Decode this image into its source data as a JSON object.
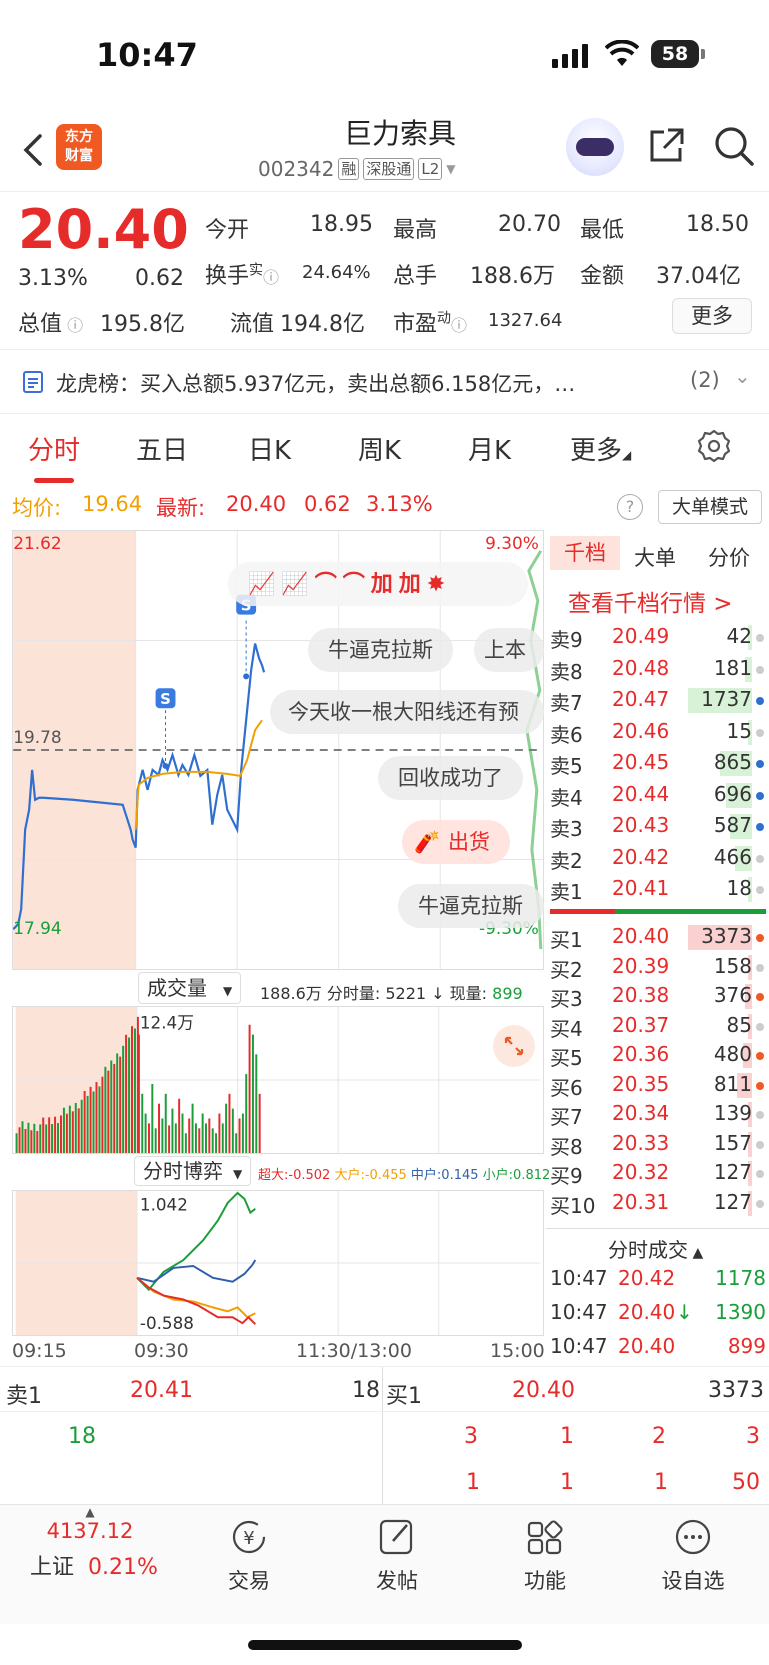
{
  "status_bar": {
    "time": "10:47",
    "battery": "58"
  },
  "nav": {
    "logo_line1": "东方",
    "logo_line2": "财富",
    "stock_name": "巨力索具",
    "stock_code": "002342",
    "tags": [
      "融",
      "深股通",
      "L2"
    ]
  },
  "quote": {
    "price": "20.40",
    "change_pct": "3.13%",
    "change": "0.62",
    "open_label": "今开",
    "open": "18.95",
    "high_label": "最高",
    "high": "20.70",
    "low_label": "最低",
    "low": "18.50",
    "turnover_label": "换手",
    "turnover_sup": "实",
    "turnover": "24.64%",
    "volume_label": "总手",
    "volume": "188.6万",
    "amount_label": "金额",
    "amount": "37.04亿",
    "mktcap_label": "总值",
    "mktcap": "195.8亿",
    "float_label": "流值",
    "float": "194.8亿",
    "pe_label": "市盈",
    "pe_sup": "动",
    "pe": "1327.64",
    "more_button": "更多"
  },
  "lhb": {
    "text": "龙虎榜：买入总额5.937亿元，卖出总额6.158亿元，…",
    "count": "(2)"
  },
  "tabs": [
    "分时",
    "五日",
    "日K",
    "周K",
    "月K",
    "更多"
  ],
  "avg_row": {
    "avg_label": "均价:",
    "avg": "19.64",
    "latest_label": "最新:",
    "latest": "20.40",
    "chg": "0.62",
    "pct": "3.13%",
    "mode_button": "大单模式",
    "help": "?"
  },
  "chart_labels": {
    "top_price": "21.62",
    "mid_price": "19.78",
    "low_price": "17.94",
    "top_pct": "9.30%",
    "low_pct": "-9.30%",
    "s_marker": "S"
  },
  "chart_data": {
    "type": "line",
    "x": [
      "09:15",
      "09:30",
      "11:30/13:00",
      "15:00"
    ],
    "ylim": [
      17.94,
      21.62
    ],
    "series": [
      {
        "name": "价格",
        "color": "#2f6fd0"
      },
      {
        "name": "均价",
        "color": "#f0a000",
        "values": [
          19.64
        ]
      }
    ]
  },
  "danmu": [
    "牛逼克拉斯",
    "上本",
    "今天收一根大阳线还有预",
    "回收成功了",
    "出货",
    "牛逼克拉斯"
  ],
  "orderbook": {
    "tabs": [
      "千档",
      "大单",
      "分价"
    ],
    "link": "查看千档行情 >",
    "asks": [
      {
        "label": "卖9",
        "price": "20.49",
        "vol": "42"
      },
      {
        "label": "卖8",
        "price": "20.48",
        "vol": "181"
      },
      {
        "label": "卖7",
        "price": "20.47",
        "vol": "1737"
      },
      {
        "label": "卖6",
        "price": "20.46",
        "vol": "15"
      },
      {
        "label": "卖5",
        "price": "20.45",
        "vol": "865"
      },
      {
        "label": "卖4",
        "price": "20.44",
        "vol": "696"
      },
      {
        "label": "卖3",
        "price": "20.43",
        "vol": "587"
      },
      {
        "label": "卖2",
        "price": "20.42",
        "vol": "466"
      },
      {
        "label": "卖1",
        "price": "20.41",
        "vol": "18"
      }
    ],
    "bids": [
      {
        "label": "买1",
        "price": "20.40",
        "vol": "3373"
      },
      {
        "label": "买2",
        "price": "20.39",
        "vol": "158"
      },
      {
        "label": "买3",
        "price": "20.38",
        "vol": "376"
      },
      {
        "label": "买4",
        "price": "20.37",
        "vol": "85"
      },
      {
        "label": "买5",
        "price": "20.36",
        "vol": "480"
      },
      {
        "label": "买6",
        "price": "20.35",
        "vol": "811"
      },
      {
        "label": "买7",
        "price": "20.34",
        "vol": "139"
      },
      {
        "label": "买8",
        "price": "20.33",
        "vol": "157"
      },
      {
        "label": "买9",
        "price": "20.32",
        "vol": "127"
      },
      {
        "label": "买10",
        "price": "20.31",
        "vol": "127"
      }
    ],
    "trades_title": "分时成交",
    "trades": [
      {
        "time": "10:47",
        "price": "20.42",
        "vol": "1178",
        "arrow": ""
      },
      {
        "time": "10:47",
        "price": "20.40",
        "vol": "1390",
        "arrow": "↓"
      },
      {
        "time": "10:47",
        "price": "20.40",
        "vol": "899",
        "arrow": ""
      }
    ]
  },
  "volume": {
    "dropdown": "成交量",
    "info": "188.6万 分时量: 5221 ↓ 现量:",
    "cur": "899",
    "max": "12.4万"
  },
  "game": {
    "dropdown": "分时博弈",
    "super_label": "超大:",
    "super": "-0.502",
    "big_label": "大户:",
    "big": "-0.455",
    "mid_label": "中户:",
    "mid": "0.145",
    "small_label": "小户:",
    "small": "0.812",
    "max": "1.042",
    "min": "-0.588"
  },
  "time_labels": [
    "09:15",
    "09:30",
    "11:30/13:00",
    "15:00"
  ],
  "bottom_quote": {
    "ask_label": "卖1",
    "ask_price": "20.41",
    "ask_vol": "18",
    "bid_label": "买1",
    "bid_price": "20.40",
    "bid_vol": "3373",
    "ask_orders": [
      "18"
    ],
    "bid_orders_row1": [
      "3",
      "1",
      "2",
      "3"
    ],
    "bid_orders_row2": [
      "1",
      "1",
      "1",
      "50"
    ]
  },
  "tabbar": {
    "index_value": "4137.12",
    "index_name": "上证",
    "index_pct": "0.21%",
    "items": [
      "交易",
      "发帖",
      "功能",
      "设自选"
    ]
  }
}
